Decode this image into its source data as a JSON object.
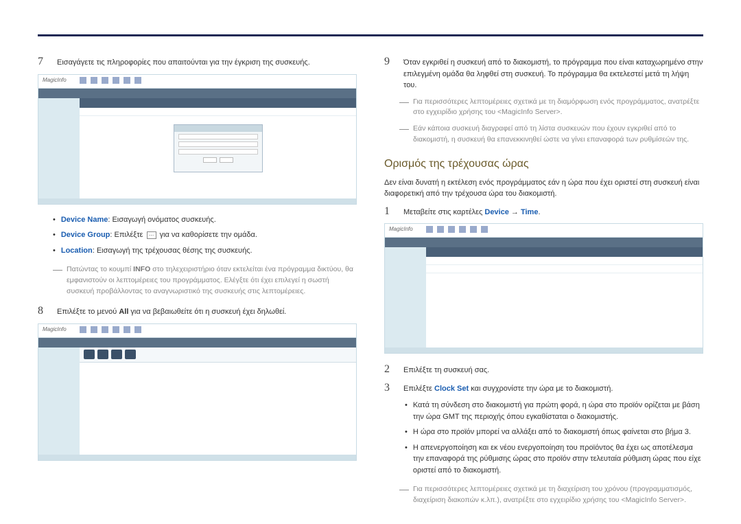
{
  "left": {
    "step7": "Εισαγάγετε τις πληροφορίες που απαιτούνται για την έγκριση της συσκευής.",
    "bullets": {
      "deviceName": {
        "label": "Device Name",
        "text": ": Εισαγωγή ονόματος συσκευής."
      },
      "deviceGroup": {
        "label": "Device Group",
        "text1": ": Επιλέξτε ",
        "text2": " για να καθορίσετε την ομάδα."
      },
      "location": {
        "label": "Location",
        "text": ": Εισαγωγή της τρέχουσας θέσης της συσκευής."
      }
    },
    "note1": {
      "pre": "Πατώντας το κουμπί ",
      "bold": "INFO",
      "post": " στο τηλεχειριστήριο όταν εκτελείται ένα πρόγραμμα δικτύου, θα εμφανιστούν οι λεπτομέρειες του προγράμματος. Ελέγξτε ότι έχει επιλεγεί η σωστή συσκευή προβάλλοντας το αναγνωριστικό της συσκευής στις λεπτομέρειες."
    },
    "step8": {
      "pre": "Επιλέξτε το μενού ",
      "bold": "All",
      "post": " για να βεβαιωθείτε ότι η συσκευή έχει δηλωθεί."
    }
  },
  "right": {
    "step9": "Όταν εγκριθεί η συσκευή από το διακομιστή, το πρόγραμμα που είναι καταχωρημένο στην επιλεγμένη ομάδα θα ληφθεί στη συσκευή. Το πρόγραμμα θα εκτελεστεί μετά τη λήψη του.",
    "note2": "Για περισσότερες λεπτομέρειες σχετικά με τη διαμόρφωση ενός προγράμματος, ανατρέξτε στο εγχειρίδιο χρήσης του <MagicInfo Server>.",
    "note3": "Εάν κάποια συσκευή διαγραφεί από τη λίστα συσκευών που έχουν εγκριθεί από το διακομιστή, η συσκευή θα επανεκκινηθεί ώστε να γίνει επαναφορά των ρυθμίσεών της.",
    "heading": "Ορισμός της τρέχουσας ώρας",
    "intro": "Δεν είναι δυνατή η εκτέλεση ενός προγράμματος εάν η ώρα που έχει οριστεί στη συσκευή είναι διαφορετική από την τρέχουσα ώρα του διακομιστή.",
    "step1": {
      "pre": "Μεταβείτε στις καρτέλες ",
      "link1": "Device",
      "arrow": " → ",
      "link2": "Time",
      "post": "."
    },
    "step2": "Επιλέξτε τη συσκευή σας.",
    "step3": {
      "pre": "Επιλέξτε ",
      "bold": "Clock Set",
      "post": " και συγχρονίστε την ώρα με το διακομιστή."
    },
    "sub_bullets": {
      "b1": "Κατά τη σύνδεση στο διακομιστή για πρώτη φορά, η ώρα στο προϊόν ορίζεται με βάση την ώρα GMT της περιοχής όπου εγκαθίσταται ο διακομιστής.",
      "b2": "Η ώρα στο προϊόν μπορεί να αλλάξει από το διακομιστή όπως φαίνεται στο βήμα 3.",
      "b3": "Η απενεργοποίηση και εκ νέου ενεργοποίηση του προϊόντος θα έχει ως αποτέλεσμα την επαναφορά της ρύθμισης ώρας στο προϊόν στην τελευταία ρύθμιση ώρας που είχε οριστεί από το διακομιστή."
    },
    "note4": "Για περισσότερες λεπτομέρειες σχετικά με τη διαχείριση του χρόνου (προγραμματισμός, διαχείριση διακοπών κ.λπ.), ανατρέξτε στο εγχειρίδιο χρήσης του <MagicInfo Server>."
  }
}
